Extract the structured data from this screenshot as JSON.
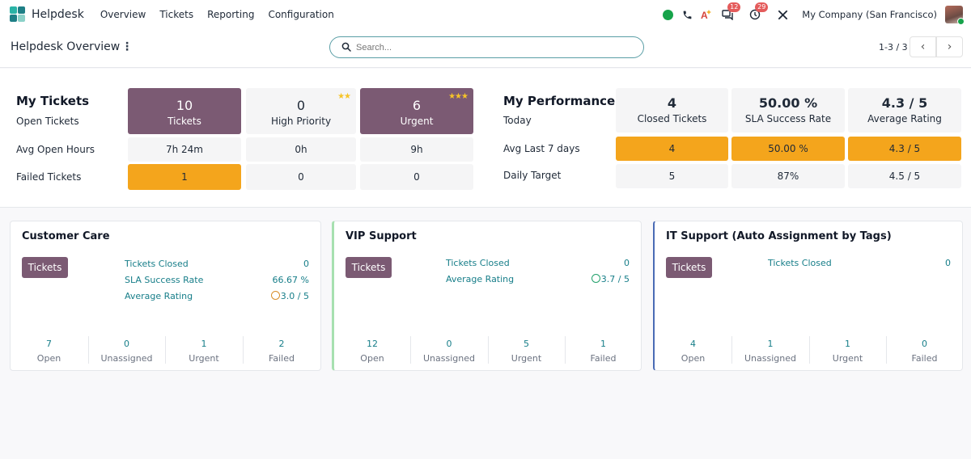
{
  "nav": {
    "brand": "Helpdesk",
    "menu": [
      "Overview",
      "Tickets",
      "Reporting",
      "Configuration"
    ],
    "messages_badge": "12",
    "activities_badge": "29",
    "company": "My Company (San Francisco)"
  },
  "control": {
    "title": "Helpdesk Overview",
    "search_placeholder": "Search...",
    "pager": "1-3 / 3"
  },
  "my_tickets": {
    "title": "My Tickets",
    "row_labels": [
      "Open Tickets",
      "Avg Open Hours",
      "Failed Tickets"
    ],
    "columns": [
      {
        "count": "10",
        "label": "Tickets",
        "stars": "",
        "avg_hours": "7h 24m",
        "failed": "1"
      },
      {
        "count": "0",
        "label": "High Priority",
        "stars": "★★",
        "avg_hours": "0h",
        "failed": "0"
      },
      {
        "count": "6",
        "label": "Urgent",
        "stars": "★★★",
        "avg_hours": "9h",
        "failed": "0"
      }
    ]
  },
  "my_performance": {
    "title": "My Performance",
    "row_labels": [
      "Today",
      "Avg Last 7 days",
      "Daily Target"
    ],
    "columns": [
      {
        "today": "4",
        "label": "Closed Tickets",
        "avg7": "4",
        "target": "5"
      },
      {
        "today": "50.00 %",
        "label": "SLA Success Rate",
        "avg7": "50.00 %",
        "target": "87%"
      },
      {
        "today": "4.3 / 5",
        "label": "Average Rating",
        "avg7": "4.3 / 5",
        "target": "4.5 / 5"
      }
    ]
  },
  "teams": [
    {
      "name": "Customer Care",
      "button": "Tickets",
      "accent": "",
      "kpis": [
        {
          "label": "Tickets Closed",
          "value": "0",
          "smiley": ""
        },
        {
          "label": "SLA Success Rate",
          "value": "66.67 %",
          "smiley": ""
        },
        {
          "label": "Average Rating",
          "value": "3.0 / 5",
          "smiley": "neutral"
        }
      ],
      "footer": [
        {
          "count": "7",
          "label": "Open"
        },
        {
          "count": "0",
          "label": "Unassigned"
        },
        {
          "count": "1",
          "label": "Urgent"
        },
        {
          "count": "2",
          "label": "Failed"
        }
      ]
    },
    {
      "name": "VIP Support",
      "button": "Tickets",
      "accent": "#a7e0b0",
      "kpis": [
        {
          "label": "Tickets Closed",
          "value": "0",
          "smiley": ""
        },
        {
          "label": "Average Rating",
          "value": "3.7 / 5",
          "smiley": "happy"
        }
      ],
      "footer": [
        {
          "count": "12",
          "label": "Open"
        },
        {
          "count": "0",
          "label": "Unassigned"
        },
        {
          "count": "5",
          "label": "Urgent"
        },
        {
          "count": "1",
          "label": "Failed"
        }
      ]
    },
    {
      "name": "IT Support (Auto Assignment by Tags)",
      "button": "Tickets",
      "accent": "#4a6bb5",
      "kpis": [
        {
          "label": "Tickets Closed",
          "value": "0",
          "smiley": ""
        }
      ],
      "footer": [
        {
          "count": "4",
          "label": "Open"
        },
        {
          "count": "1",
          "label": "Unassigned"
        },
        {
          "count": "1",
          "label": "Urgent"
        },
        {
          "count": "0",
          "label": "Failed"
        }
      ]
    }
  ],
  "colors": {
    "primary": "#7b5a73",
    "highlight": "#f4a51c",
    "link": "#177e89",
    "status_online": "#16a34a",
    "badge": "#e45b5b"
  }
}
